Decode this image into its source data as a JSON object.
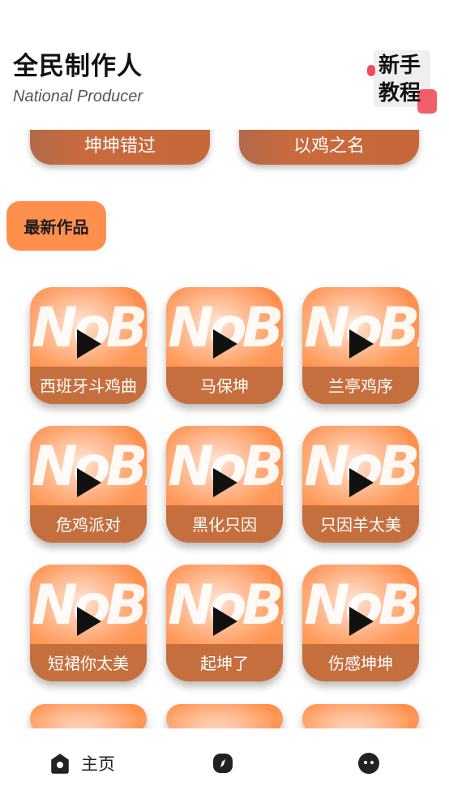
{
  "header": {
    "title": "全民制作人",
    "subtitle": "National Producer",
    "tutorial_label": "新手教程"
  },
  "featured": [
    {
      "label": "坤坤错过"
    },
    {
      "label": "以鸡之名"
    }
  ],
  "section": {
    "label": "最新作品"
  },
  "works": [
    {
      "name": "西班牙斗鸡曲",
      "logo": "NoBr"
    },
    {
      "name": "马保坤",
      "logo": "NoBr"
    },
    {
      "name": "兰亭鸡序",
      "logo": "NoBr"
    },
    {
      "name": "危鸡派对",
      "logo": "NoBr"
    },
    {
      "name": "黑化只因",
      "logo": "NoBr"
    },
    {
      "name": "只因羊太美",
      "logo": "NoBr"
    },
    {
      "name": "短裙你太美",
      "logo": "NoBr"
    },
    {
      "name": "起坤了",
      "logo": "NoBr"
    },
    {
      "name": "伤感坤坤",
      "logo": "NoBr"
    }
  ],
  "nav": {
    "home_label": "主页",
    "home_icon": "home-icon",
    "discover_icon": "compass-icon",
    "profile_icon": "chat-face-icon"
  },
  "colors": {
    "accent": "#ff8f4d",
    "card_band": "#c66f3e",
    "featured_card": "#c7683a",
    "red_accent": "#ef4d5c"
  }
}
